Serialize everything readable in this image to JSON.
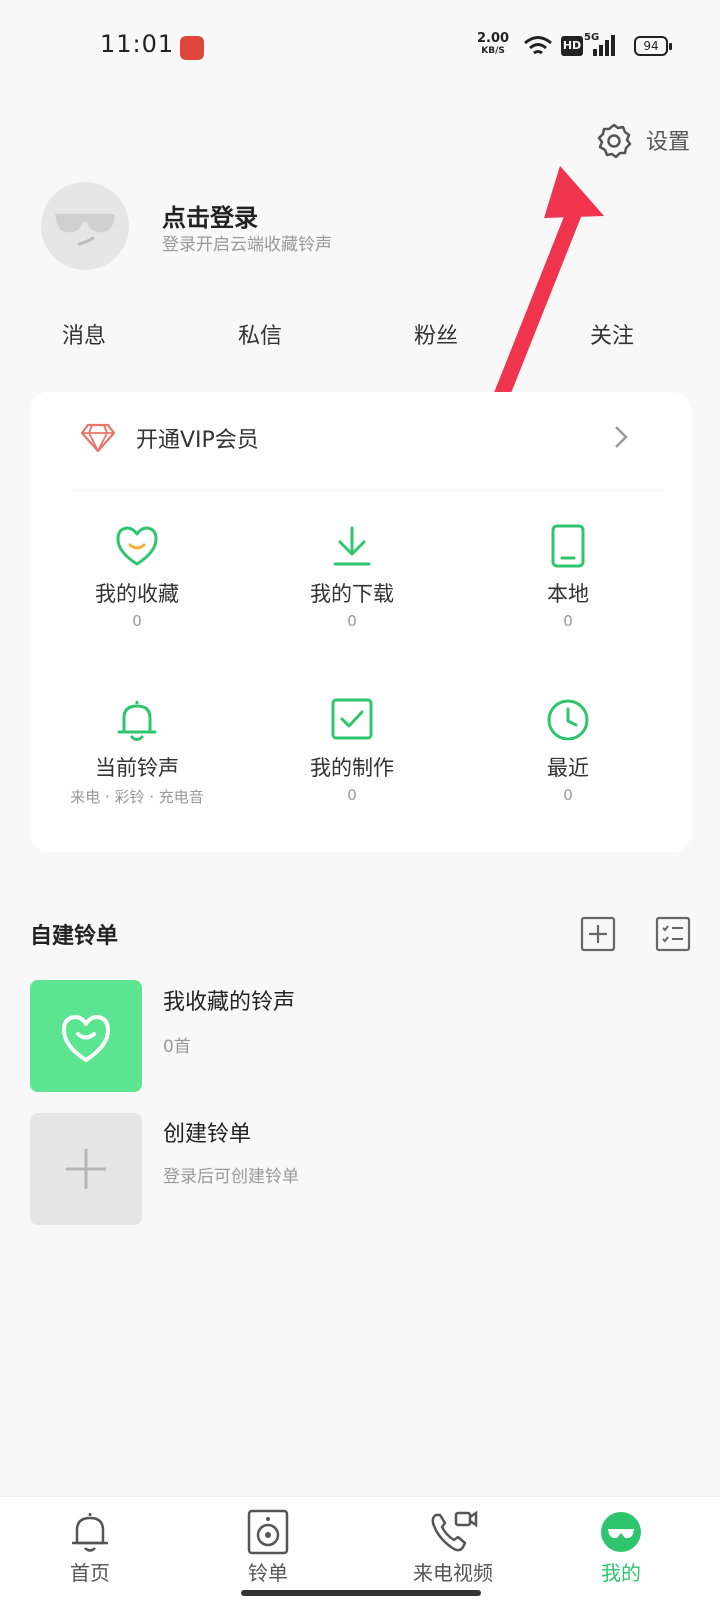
{
  "status_bar": {
    "time": "11:01",
    "net_speed": "2.00",
    "net_unit": "KB/S",
    "network": "5G",
    "hd": "HD",
    "battery": "94"
  },
  "header": {
    "settings_label": "设置"
  },
  "profile": {
    "login_title": "点击登录",
    "login_subtitle": "登录开启云端收藏铃声"
  },
  "stats": [
    {
      "label": "消息"
    },
    {
      "label": "私信"
    },
    {
      "label": "粉丝"
    },
    {
      "label": "关注"
    }
  ],
  "vip": {
    "label": "开通VIP会员"
  },
  "grid": [
    {
      "label": "我的收藏",
      "count": "0",
      "icon": "heart-smile-icon"
    },
    {
      "label": "我的下载",
      "count": "0",
      "icon": "download-icon"
    },
    {
      "label": "本地",
      "count": "0",
      "icon": "phone-local-icon"
    },
    {
      "label": "当前铃声",
      "count": "来电 · 彩铃 · 充电音",
      "icon": "bell-icon"
    },
    {
      "label": "我的制作",
      "count": "0",
      "icon": "checkbox-icon"
    },
    {
      "label": "最近",
      "count": "0",
      "icon": "clock-icon"
    }
  ],
  "playlists": {
    "section_title": "自建铃单",
    "items": [
      {
        "title": "我收藏的铃声",
        "subtitle": "0首"
      },
      {
        "title": "创建铃单",
        "subtitle": "登录后可创建铃单"
      }
    ]
  },
  "nav": [
    {
      "label": "首页",
      "icon": "bell-outline-icon",
      "active": false
    },
    {
      "label": "铃单",
      "icon": "speaker-icon",
      "active": false
    },
    {
      "label": "来电视频",
      "icon": "phone-video-icon",
      "active": false
    },
    {
      "label": "我的",
      "icon": "avatar-icon",
      "active": true
    }
  ],
  "colors": {
    "accent": "#2fc56f",
    "thumb_green": "#5ce590",
    "arrow_red": "#f0344e",
    "vip_diamond": "#e8756a"
  }
}
